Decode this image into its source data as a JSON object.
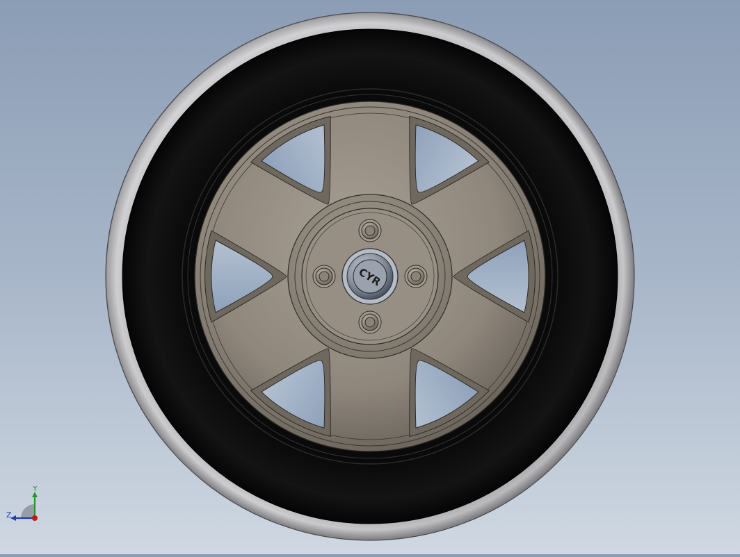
{
  "viewport": {
    "background_top": "#8b9db5",
    "background_bottom": "#cfd8e2"
  },
  "model": {
    "center_cap_logo": "CYR",
    "spoke_count": 6,
    "lug_nut_count": 4,
    "colors": {
      "tire": "#0d0d0d",
      "tire_sidewall": "#b8b8ba",
      "rim": "#8f877c",
      "rim_highlight": "#c4bcb0",
      "hub_cap": "#8a9099"
    }
  },
  "triad": {
    "y_label": "Y",
    "z_label": "Z",
    "colors": {
      "y": "#1f9a2a",
      "z": "#1f3fb0",
      "x": "#c0181d"
    }
  }
}
